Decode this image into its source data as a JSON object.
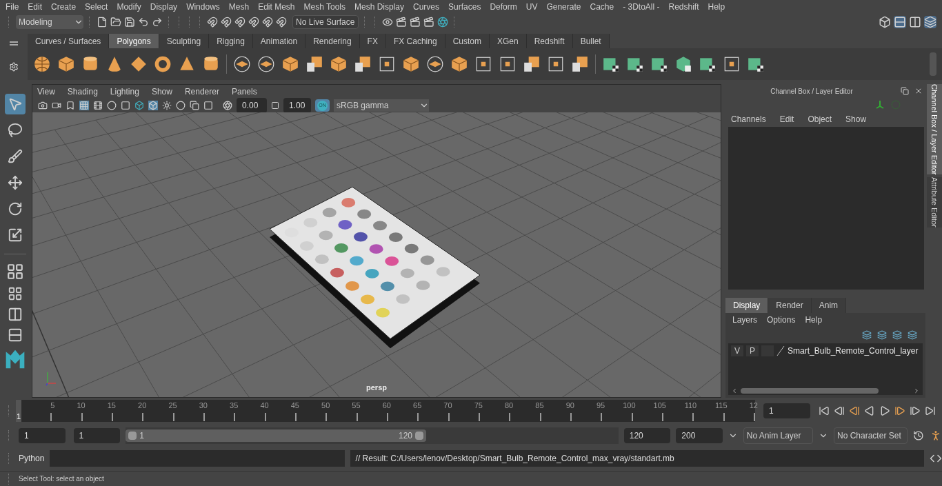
{
  "menu_bar": [
    "File",
    "Edit",
    "Create",
    "Select",
    "Modify",
    "Display",
    "Windows",
    "Mesh",
    "Edit Mesh",
    "Mesh Tools",
    "Mesh Display",
    "Curves",
    "Surfaces",
    "Deform",
    "UV",
    "Generate",
    "Cache",
    "- 3DtoAll -",
    "Redshift",
    "Help"
  ],
  "status_line": {
    "workspace": "Modeling",
    "live_surface": "No Live Surface"
  },
  "shelf_tabs": [
    {
      "label": "Curves / Surfaces",
      "selected": false
    },
    {
      "label": "Polygons",
      "selected": true
    },
    {
      "label": "Sculpting",
      "selected": false
    },
    {
      "label": "Rigging",
      "selected": false
    },
    {
      "label": "Animation",
      "selected": false
    },
    {
      "label": "Rendering",
      "selected": false
    },
    {
      "label": "FX",
      "selected": false
    },
    {
      "label": "FX Caching",
      "selected": false
    },
    {
      "label": "Custom",
      "selected": false
    },
    {
      "label": "XGen",
      "selected": false
    },
    {
      "label": "Redshift",
      "selected": false
    },
    {
      "label": "Bullet",
      "selected": false
    }
  ],
  "toolbox": [
    {
      "selected": true
    },
    {
      "selected": false
    },
    {
      "selected": false
    },
    {
      "selected": false
    },
    {
      "selected": false
    },
    {
      "selected": false
    }
  ],
  "viewport": {
    "menu": [
      "View",
      "Shading",
      "Lighting",
      "Show",
      "Renderer",
      "Panels"
    ],
    "exposure": "0.00",
    "gamma": "1.00",
    "color_management": "ON",
    "color_space": "sRGB gamma",
    "camera_label": "persp"
  },
  "channel_box": {
    "title": "Channel Box / Layer Editor",
    "menu": [
      "Channels",
      "Edit",
      "Object",
      "Show"
    ]
  },
  "layer_editor": {
    "tabs": [
      {
        "label": "Display",
        "selected": true
      },
      {
        "label": "Render",
        "selected": false
      },
      {
        "label": "Anim",
        "selected": false
      }
    ],
    "menu": [
      "Layers",
      "Options",
      "Help"
    ],
    "layers": [
      {
        "visible": "V",
        "playback": "P",
        "name": "Smart_Bulb_Remote_Control_layer"
      }
    ]
  },
  "side_tabs": [
    {
      "label": "Channel Box / Layer Editor",
      "selected": true
    },
    {
      "label": "Attribute Editor",
      "selected": false
    }
  ],
  "timeline": {
    "current_frame": "1",
    "ticks": [
      "5",
      "10",
      "15",
      "20",
      "25",
      "30",
      "35",
      "40",
      "45",
      "50",
      "55",
      "60",
      "65",
      "70",
      "75",
      "80",
      "85",
      "90",
      "95",
      "100",
      "105",
      "110",
      "115",
      "12"
    ],
    "frame_field": "1"
  },
  "range": {
    "level": 0.61,
    "start": "1",
    "playback_start": "1",
    "slider_start": "1",
    "slider_end": "120",
    "playback_end": "120",
    "end": "200",
    "anim_layer": "No Anim Layer",
    "character_set": "No Character Set"
  },
  "command_line": {
    "language": "Python",
    "result": "// Result: C:/Users/lenov/Desktop/Smart_Bulb_Remote_Control_max_vray/standart.mb"
  },
  "help_line": "Select Tool: select an object"
}
